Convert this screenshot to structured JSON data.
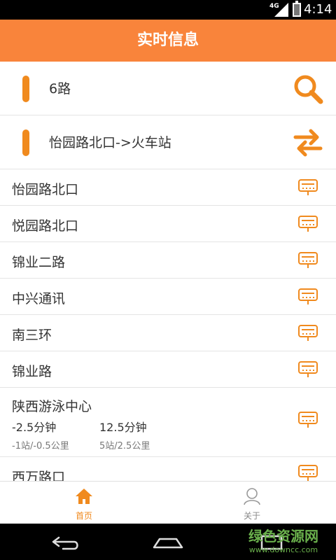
{
  "status_bar": {
    "network": "4G",
    "time": "4:14"
  },
  "title": "实时信息",
  "line": {
    "name": "6路",
    "search_icon": "search-icon"
  },
  "direction": {
    "text": "怡园路北口->火车站",
    "swap_icon": "swap-icon"
  },
  "stops": [
    {
      "name": "怡园路北口"
    },
    {
      "name": "悦园路北口"
    },
    {
      "name": "锦业二路"
    },
    {
      "name": "中兴通讯"
    },
    {
      "name": "南三环"
    },
    {
      "name": "锦业路"
    },
    {
      "name": "陕西游泳中心",
      "bus1_time": "-2.5分钟",
      "bus1_dist": "-1站/-0.5公里",
      "bus2_time": "12.5分钟",
      "bus2_dist": "5站/2.5公里"
    },
    {
      "name": "西万路口"
    }
  ],
  "tabs": [
    {
      "label": "首页",
      "icon": "home-icon"
    },
    {
      "label": "关于",
      "icon": "person-icon"
    }
  ],
  "colors": {
    "accent": "#f9843b",
    "icon_orange": "#f08a1e",
    "tab_inactive": "#888888"
  },
  "watermark": {
    "line1": "绿色资源网",
    "line2": "www.downcc.com"
  }
}
